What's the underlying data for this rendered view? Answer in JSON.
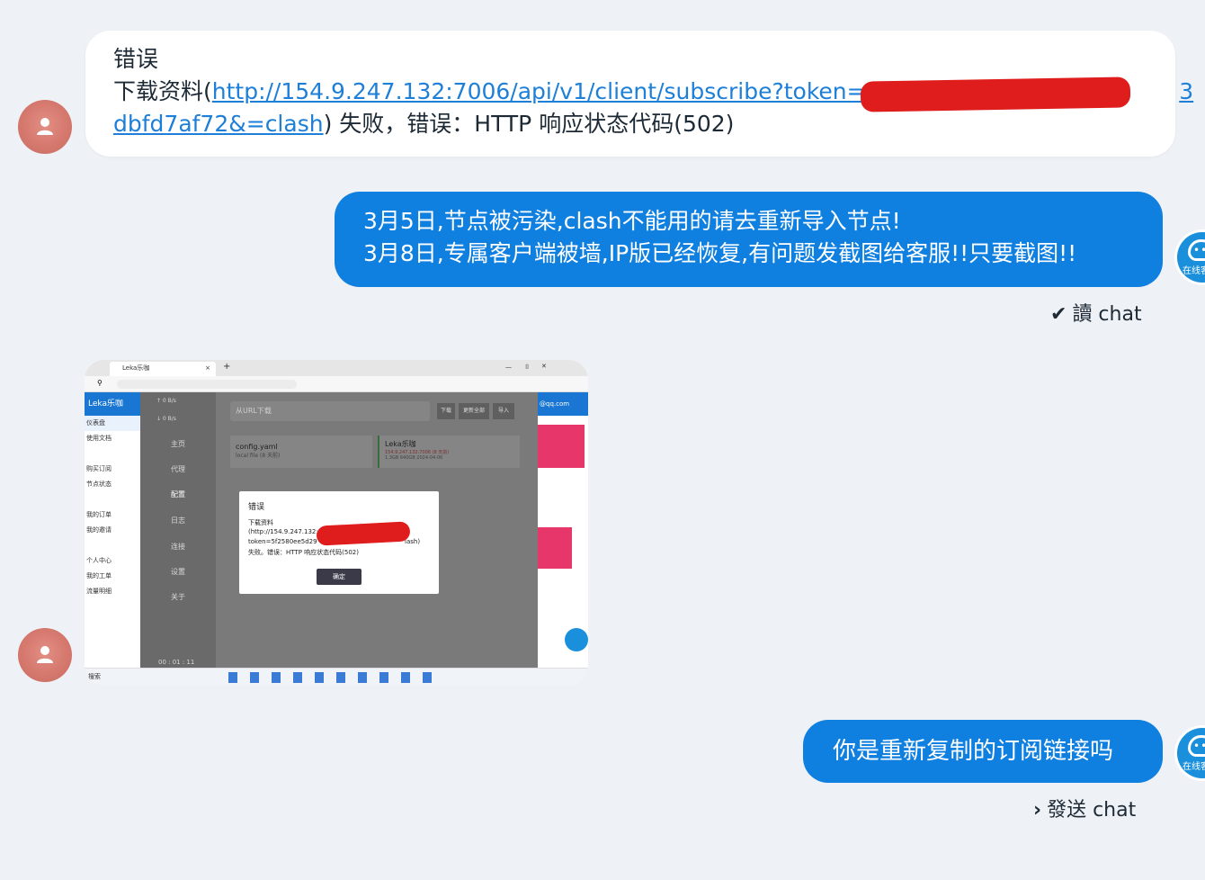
{
  "incoming_message": {
    "title": "错误",
    "prefix": "下载资料(",
    "link_part1": "http://154.9.247.132:7006/api/v1/client/subscribe?token=5f2",
    "link_part2": "3",
    "link_part3": "dbfd7af72&=clash",
    "suffix": ") 失败，错误：HTTP 响应状态代码(502)"
  },
  "outgoing_message_1": {
    "line1": "3月5日,节点被污染,clash不能用的请去重新导入节点!",
    "line2": "3月8日,专属客户端被墙,IP版已经恢复,有问题发截图给客服!!只要截图!!"
  },
  "status_1": {
    "icon": "check-icon",
    "text": "讀 chat"
  },
  "operator_avatar_label": "在线客服",
  "screenshot": {
    "app_name": "Leka乐咖",
    "url_placeholder": "从URL下载",
    "buttons": [
      "下载",
      "更新全部",
      "导入"
    ],
    "nav": [
      "主页",
      "代理",
      "配置",
      "日志",
      "连接",
      "设置",
      "关于"
    ],
    "sidebar": [
      "仪表盘",
      "使用文档",
      "",
      "购买订阅",
      "节点状态",
      "",
      "我的订单",
      "我的邀请",
      "",
      "个人中心",
      "我的工单",
      "流量明细"
    ],
    "speed_up": "↑ 0 B/s",
    "speed_down": "↓ 0 B/s",
    "profile_local_name": "config.yaml",
    "profile_local_sub": "local file (8 天前)",
    "profile_remote_name": "Leka乐咖",
    "profile_remote_sub": "154.9.247.132:7006 (8 天前)",
    "profile_remote_meta": "1.3GB  640GB  2024-04-06",
    "email": "@qq.com",
    "dialog": {
      "title": "错误",
      "line1": "下载资料",
      "line2": "(http://154.9.247.132:",
      "line3": "token=5f2580ee5d29",
      "line3b": "lash)",
      "line4": "失败。错误：HTTP 响应状态代码(502)",
      "ok": "确定"
    },
    "timer": "00 : 01 : 11",
    "search": "搜索"
  },
  "outgoing_message_2": {
    "text": "你是重新复制的订阅链接吗"
  },
  "status_2": {
    "icon": "chevron-right-icon",
    "text": "發送 chat"
  },
  "colors": {
    "bubble_blue": "#0f7fe0",
    "link_blue": "#1d7fd8",
    "background": "#eef1f5",
    "redact_red": "#e01d1d"
  }
}
